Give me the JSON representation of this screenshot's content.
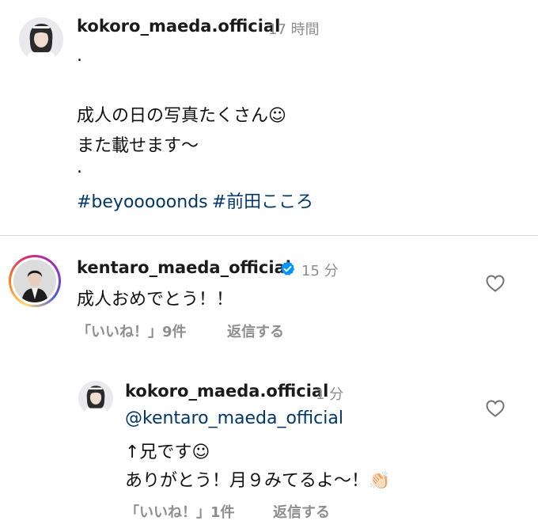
{
  "post": {
    "author": "kokoro_maeda.official",
    "time": "17 時間",
    "caption_lines": [
      ".",
      "成人の日の写真たくさん☺︎",
      "また載せます〜",
      "."
    ],
    "hashtags": [
      "#beyooooonds",
      "#前田こころ"
    ]
  },
  "comment": {
    "author": "kentaro_maeda_official",
    "verified": true,
    "time": "15 分",
    "text": "成人おめでとう！！",
    "likes": "「いいね！」9件",
    "reply_label": "返信する",
    "like_icon": "heart-outline"
  },
  "reply": {
    "author": "kokoro_maeda.official",
    "time": "1 分",
    "mention": "@kentaro_maeda_official",
    "lines": [
      "↑兄です☺︎",
      "ありがとう！月９みてるよ〜！👏🏻"
    ],
    "likes": "「いいね！」1件",
    "reply_label": "返信する",
    "like_icon": "heart-outline"
  },
  "colors": {
    "link": "#00376b",
    "muted": "#8e8e8e",
    "verified": "#0095f6",
    "divider": "#dbdbdb"
  }
}
